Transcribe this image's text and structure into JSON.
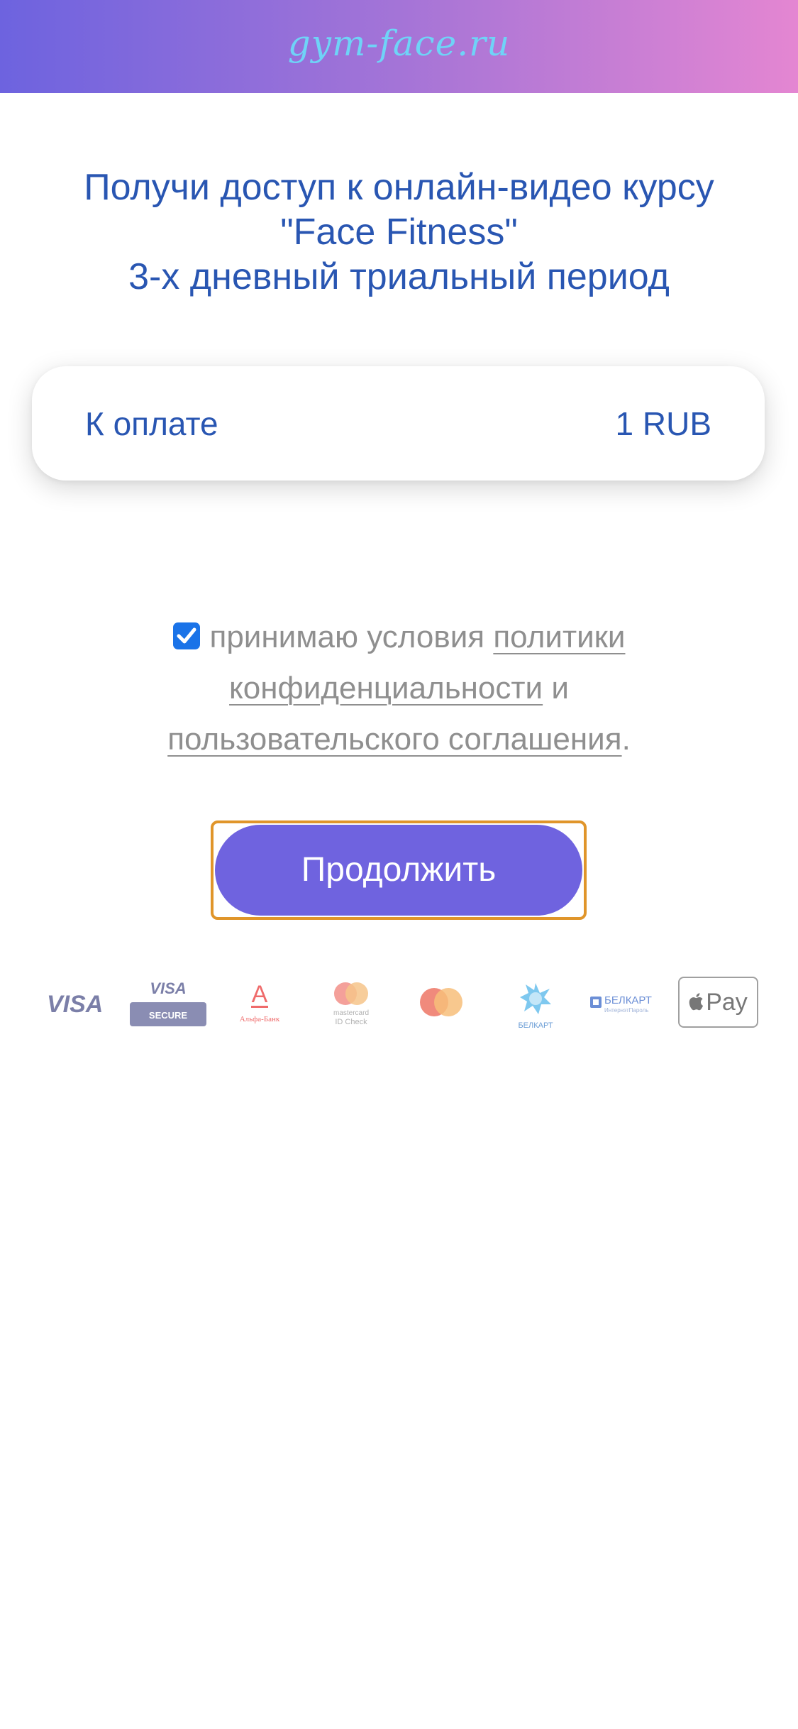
{
  "header": {
    "logo_text": "gym-face.ru"
  },
  "offer": {
    "title_line1": "Получи доступ к онлайн-видео курсу",
    "title_line2": "\"Face Fitness\"",
    "title_line3": "3-х дневный триальный период"
  },
  "payment": {
    "label": "К оплате",
    "amount": "1 RUB"
  },
  "terms": {
    "checked": true,
    "text_prefix": "принимаю условия",
    "privacy_link_part1": "политики",
    "privacy_link_part2": "конфиденциальности",
    "connector": "и",
    "agreement_link": "пользовательского соглашения",
    "suffix": "."
  },
  "actions": {
    "continue_label": "Продолжить"
  },
  "payment_logos": {
    "visa": "VISA",
    "visa_secure_top": "VISA",
    "visa_secure_bottom": "SECURE",
    "alfa_letter": "А",
    "alfa_name": "Альфа-Банк",
    "mc_id_check_line1": "mastercard",
    "mc_id_check_line2": "ID Check",
    "belkart_name": "БЕЛКАРТ",
    "belkart_internet_name": "БЕЛКАРТ",
    "belkart_internet_sub": "ИнтернэтПароль",
    "apple_pay": "Pay"
  },
  "colors": {
    "accent": "#6f63df",
    "title_blue": "#2956b2",
    "muted_text": "#8f8f8f",
    "focus_outline": "#e0952a",
    "header_gradient_start": "#6d63df",
    "header_gradient_end": "#e486d2"
  }
}
